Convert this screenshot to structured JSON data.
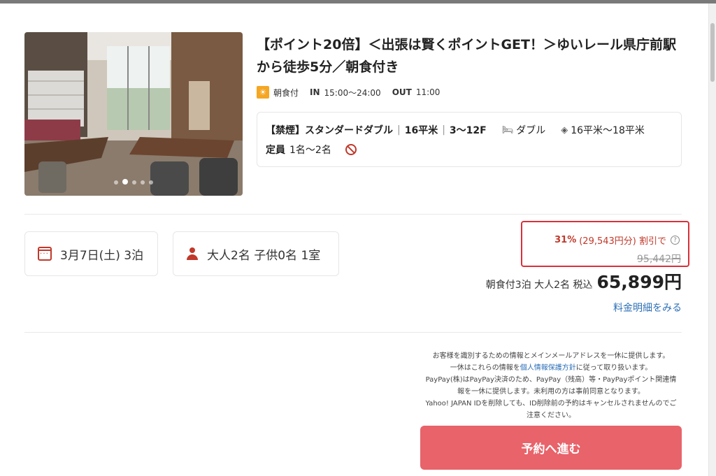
{
  "hotel": {
    "title": "【ポイント20倍】＜出張は賢くポイントGET！＞ゆいレール県庁前駅から徒歩5分／朝食付き",
    "meal": "朝食付",
    "checkin_label": "IN",
    "checkin_time": "15:00〜24:00",
    "checkout_label": "OUT",
    "checkout_time": "11:00"
  },
  "photo": {
    "dots": 5,
    "active_dot": 2
  },
  "room": {
    "smoking": "【禁煙】",
    "type": "スタンダードダブル",
    "size": "16平米",
    "floors": "3〜12F",
    "bed": "ダブル",
    "area_range": "16平米〜18平米",
    "capacity_label": "定員",
    "capacity": "1名〜2名"
  },
  "search": {
    "date": "3月7日(土) 3泊",
    "guests": "大人2名 子供0名 1室"
  },
  "pricing": {
    "discount_pct": "31%",
    "discount_amount": "(29,543円分) 割引で",
    "original_price": "95,442円",
    "price_desc": "朝食付3泊 大人2名 税込",
    "price": "65,899円",
    "detail_link": "料金明細をみる"
  },
  "notice": {
    "line1": "お客様を識別するための情報とメインメールアドレスを一休に提供します。",
    "line2_a": "一休はこれらの情報を",
    "line2_link": "個人情報保護方針",
    "line2_b": "に従って取り扱います。",
    "line3": "PayPay(株)はPayPay決済のため、PayPay（残高）等・PayPayポイント関連情",
    "line4": "報を一休に提供します。未利用の方は事前同意となります。",
    "line5": "Yahoo! JAPAN IDを削除しても、ID削除前の予約はキャンセルされませんのでご",
    "line6": "注意ください。"
  },
  "actions": {
    "reserve": "予約へ進む"
  },
  "colors": {
    "accent_red": "#d9303b",
    "button_bg": "#e8636a",
    "link_blue": "#2c6fb7"
  }
}
